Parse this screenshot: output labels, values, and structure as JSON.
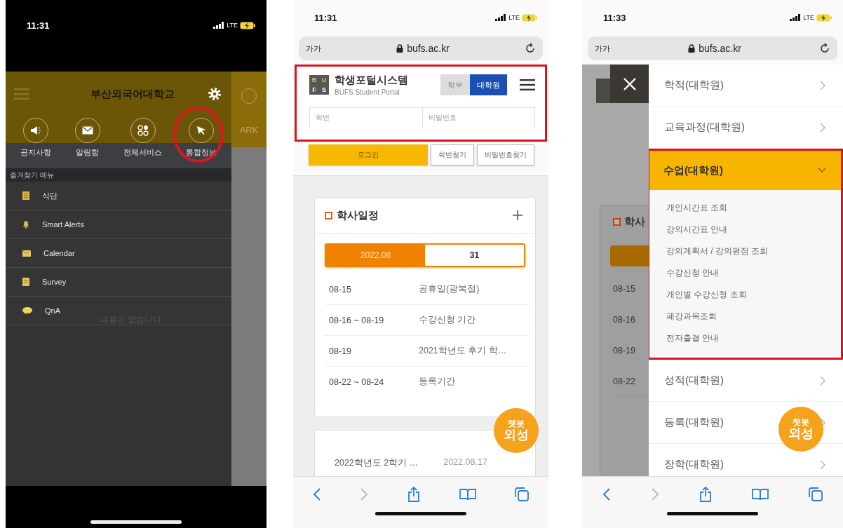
{
  "phone_app": {
    "status_bar": {
      "time": "11:31",
      "network": "LTE"
    },
    "header": {
      "title": "부산외국어대학교"
    },
    "quick_menu": [
      {
        "label": "공지사항",
        "circled": false
      },
      {
        "label": "알림함",
        "circled": false
      },
      {
        "label": "전체서비스",
        "circled": false
      },
      {
        "label": "통합정보",
        "circled": true
      }
    ],
    "favorites": {
      "title": "즐겨찾기 메뉴",
      "items": [
        "식단",
        "Smart Alerts",
        "Calendar",
        "Survey",
        "QnA"
      ],
      "empty_text": "내용이 없습니다"
    },
    "side_strip": {
      "text": "ARK"
    }
  },
  "phone_portal": {
    "status_bar": {
      "time": "11:31",
      "network": "LTE"
    },
    "address_bar": {
      "text_size": "가가",
      "url": "bufs.ac.kr"
    },
    "login_panel": {
      "highlighted": true,
      "logo_letters": [
        "B",
        "U",
        "F",
        "S"
      ],
      "title": "학생포털시스템",
      "subtitle": "BUFS Student Portal",
      "toggle": [
        {
          "label": "학부",
          "selected": false
        },
        {
          "label": "대학원",
          "selected": true
        }
      ],
      "id_placeholder": "학번",
      "password_placeholder": "비밀번호"
    },
    "buttons": [
      "로그인",
      "학번찾기",
      "비밀번호찾기"
    ],
    "schedule": {
      "title": "학사일정",
      "month": "2022.08",
      "day": "31",
      "rows": [
        {
          "date": "08-15",
          "event": "공휴일(광복절)"
        },
        {
          "date": "08-16 ~ 08-19",
          "event": "수강신청 기간"
        },
        {
          "date": "08-19",
          "event": "2021학년도 후기 학…"
        },
        {
          "date": "08-22 ~ 08-24",
          "event": "등록기간"
        }
      ]
    },
    "notice": {
      "title": "2022학년도 2학기 …",
      "date": "2022.08.17"
    },
    "chatbot": {
      "lines": [
        "챗봇",
        "외성"
      ]
    }
  },
  "phone_menu": {
    "status_bar": {
      "time": "11:33",
      "network": "LTE"
    },
    "address_bar": {
      "text_size": "가가",
      "url": "bufs.ac.kr"
    },
    "backdrop": {
      "card_title": "학사",
      "dates": [
        "08-15",
        "08-16",
        "08-19",
        "08-22"
      ]
    },
    "menu": [
      {
        "label": "학적(대학원)",
        "expanded": false,
        "highlighted": false
      },
      {
        "label": "교육과정(대학원)",
        "expanded": false,
        "highlighted": false
      },
      {
        "label": "수업(대학원)",
        "expanded": true,
        "highlighted": true,
        "children": [
          "개인시간표 조회",
          "강의시간표 안내",
          "강의계획서 / 강의평점 조회",
          "수강신청 안내",
          "개인별 수강신청 조회",
          "폐강과목조회",
          "전자출결 안내"
        ]
      },
      {
        "label": "성적(대학원)",
        "expanded": false,
        "highlighted": false
      },
      {
        "label": "등록(대학원)",
        "expanded": false,
        "highlighted": false
      },
      {
        "label": "장학(대학원)",
        "expanded": false,
        "highlighted": false
      }
    ],
    "chatbot": {
      "lines": [
        "챗봇",
        "외성"
      ]
    }
  }
}
